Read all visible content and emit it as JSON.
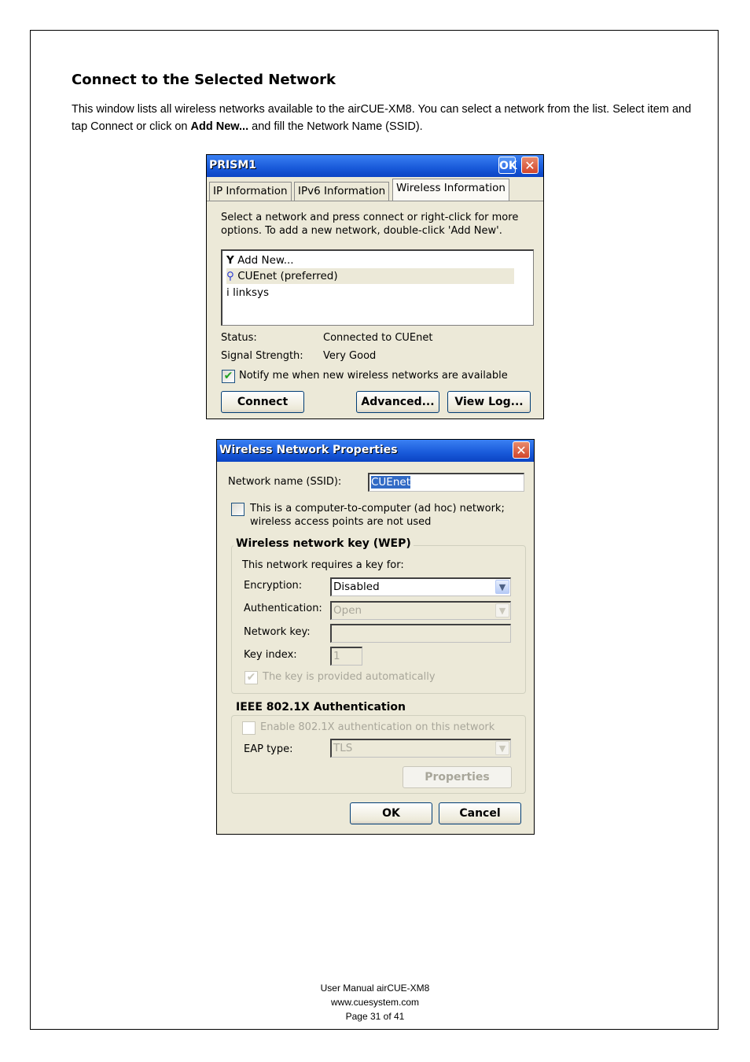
{
  "document": {
    "heading": "Connect to the Selected Network",
    "intro_part1": "This window lists all wireless networks available to the airCUE-XM8. You can select a network from the list. Select item and tap Connect or click on ",
    "intro_bold": "Add New...",
    "intro_part2": " and fill the Network Name (SSID)."
  },
  "prism_window": {
    "title": "PRISM1",
    "ok_button": "OK",
    "close_button": "✕",
    "tabs": [
      {
        "label": "IP Information",
        "active": false
      },
      {
        "label": "IPv6 Information",
        "active": false
      },
      {
        "label": "Wireless Information",
        "active": true
      }
    ],
    "instructions_line1": "Select a network and press connect or right-click for more",
    "instructions_line2": "options.  To add a new network, double-click 'Add New'.",
    "networks": [
      {
        "icon": "antenna-icon",
        "label": "Add New...",
        "selected": false
      },
      {
        "icon": "access-point-preferred-icon",
        "label": "CUEnet (preferred)",
        "selected": true
      },
      {
        "icon": "access-point-icon",
        "label": "linksys",
        "selected": false
      }
    ],
    "status_label": "Status:",
    "status_value": "Connected to CUEnet",
    "signal_label": "Signal Strength:",
    "signal_value": "Very Good",
    "notify_checkbox": {
      "label": "Notify me when new wireless networks are available",
      "checked": true
    },
    "buttons": {
      "connect": "Connect",
      "advanced": "Advanced...",
      "view_log": "View Log..."
    }
  },
  "properties_window": {
    "title": "Wireless Network Properties",
    "close_button": "✕",
    "ssid_label": "Network name (SSID):",
    "ssid_value": "CUEnet",
    "adhoc_checkbox": {
      "line1": "This is a computer-to-computer (ad hoc) network;",
      "line2": "wireless access points are not used",
      "checked": false
    },
    "wep_group": {
      "title": "Wireless network key (WEP)",
      "requires_label": "This network requires a key for:",
      "encryption_label": "Encryption:",
      "encryption_value": "Disabled",
      "authentication_label": "Authentication:",
      "authentication_value": "Open",
      "network_key_label": "Network key:",
      "network_key_value": "",
      "key_index_label": "Key index:",
      "key_index_value": "1",
      "auto_key_checkbox": {
        "label": "The key is provided automatically",
        "checked": true,
        "disabled": true
      }
    },
    "ieee_group": {
      "title": "IEEE 802.1X Authentication",
      "enable_checkbox": {
        "label": "Enable 802.1X authentication on this network",
        "checked": false,
        "disabled": true
      },
      "eap_label": "EAP type:",
      "eap_value": "TLS",
      "properties_button": "Properties"
    },
    "buttons": {
      "ok": "OK",
      "cancel": "Cancel"
    }
  },
  "footer": {
    "line1": "User Manual airCUE-XM8",
    "line2": "www.cuesystem.com",
    "line3": "Page 31 of 41"
  }
}
